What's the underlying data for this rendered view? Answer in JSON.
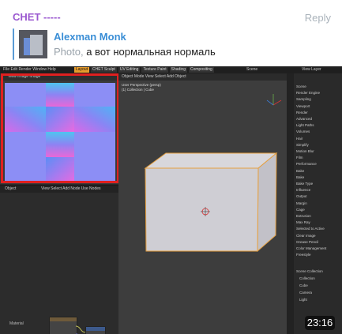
{
  "chat": {
    "name": "CHET -----",
    "reply_label": "Reply"
  },
  "quote": {
    "author": "Alexman Monk",
    "media_type": "Photo,",
    "text": "а вот нормальная нормаль"
  },
  "blender": {
    "menu": "File  Edit  Render  Window  Help",
    "tabs": [
      "Layout",
      "CHET Sculpt",
      "UV Editing",
      "Texture Paint",
      "Shading",
      "Compositing"
    ],
    "active_tab": "Layout",
    "scene": "Scene",
    "view_layer": "View Layer",
    "uv_toolbar": "View   Image   Image*",
    "node_toolbar": "Object",
    "node_menu": "View   Select   Add   Node",
    "use_nodes": "Use Nodes",
    "material_label": "Material",
    "viewport_header": "Object Mode   View   Select   Add   Object",
    "viewport_info_1": "User Perspective (persp)",
    "viewport_info_2": "(1) Collection | Cube",
    "properties": [
      "Scene",
      "Render Engine",
      "Sampling",
      "Viewport",
      "Render",
      "Advanced",
      "Light Paths",
      "Volumes",
      "Hair",
      "Simplify",
      "Motion Blur",
      "Film",
      "Performance",
      "Bake",
      "Bake",
      "Bake Type",
      "Influence",
      "Output",
      "Margin",
      "Cage",
      "Extrusion",
      "Max Ray",
      "Selected to Active",
      "Clear Image",
      "Grease Pencil",
      "Color Management",
      "Freestyle"
    ],
    "outliner": [
      "Scene Collection",
      "Collection",
      "Cube",
      "Camera",
      "Light"
    ]
  },
  "video": {
    "timestamp": "23:16"
  },
  "colors": {
    "chat_name": "#9b59d0",
    "author": "#3a8ed6",
    "highlight_box": "#e02020",
    "active_tab": "#e89c2c"
  }
}
